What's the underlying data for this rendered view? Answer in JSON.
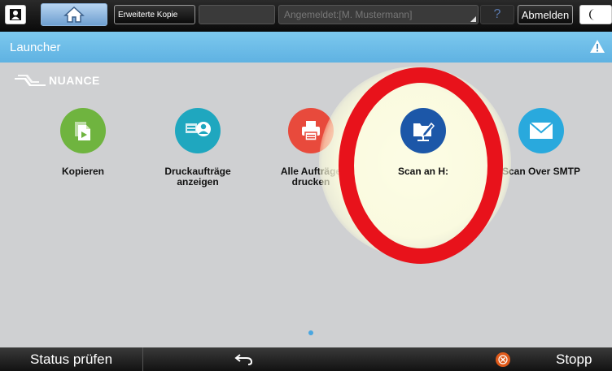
{
  "topbar": {
    "user_icon": "user-icon",
    "home_icon": "home-icon",
    "program_label": "Erweiterte Kopie",
    "login_status": "Angemeldet:[M. Mustermann]",
    "help_label": "?",
    "logout_label": "Abmelden",
    "moon_icon": "moon-icon"
  },
  "header": {
    "title": "Launcher",
    "warning_icon": "warning-icon"
  },
  "main": {
    "brand": "NUANCE",
    "apps": [
      {
        "label": "Kopieren",
        "icon": "copy-icon",
        "color": "#6fb43f"
      },
      {
        "label": "Druckaufträge\nanzeigen",
        "icon": "print-jobs-icon",
        "color": "#1fa7bf"
      },
      {
        "label": "Alle Aufträge\ndrucken",
        "icon": "printer-icon",
        "color": "#e84a3c"
      },
      {
        "label": "Scan an H:",
        "icon": "scan-folder-icon",
        "color": "#1c57a8"
      },
      {
        "label": "Scan Over SMTP",
        "icon": "mail-icon",
        "color": "#29a9dd"
      }
    ],
    "highlight_color": "#e8121b"
  },
  "bottombar": {
    "status_label": "Status prüfen",
    "back_icon": "back-arrow-icon",
    "stop_icon": "stop-icon",
    "stop_label": "Stopp"
  }
}
